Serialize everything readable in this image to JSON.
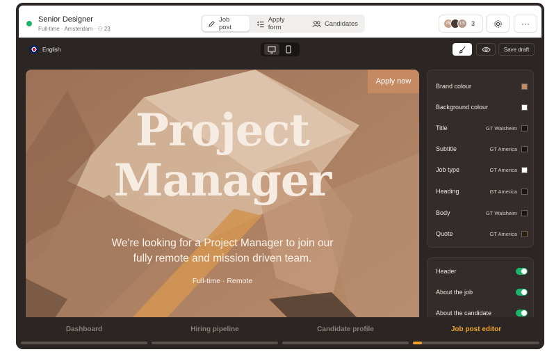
{
  "header": {
    "job_title": "Senior Designer",
    "job_meta": "Full-time · Amsterdam · ⚇ 23",
    "tabs": [
      {
        "label": "Job post",
        "icon": "pencil-icon",
        "active": true
      },
      {
        "label": "Apply form",
        "icon": "checklist-icon",
        "active": false
      },
      {
        "label": "Candidates",
        "icon": "users-icon",
        "active": false
      }
    ],
    "avatars": [
      "IB",
      "",
      "LS"
    ],
    "avatar_count": "3",
    "settings_icon": "gear-icon",
    "more_icon": "ellipsis-icon"
  },
  "toolbar": {
    "language": "English",
    "save_label": "Save draft"
  },
  "hero": {
    "apply_label": "Apply now",
    "title_line1": "Project",
    "title_line2": "Manager",
    "subtitle_line1": "We're looking for a Project Manager to join our",
    "subtitle_line2": "fully remote and mission driven team.",
    "meta": "Full-time · Remote"
  },
  "style_panel": {
    "rows": [
      {
        "label": "Brand colour",
        "value": "",
        "swatch": "#c58a62"
      },
      {
        "label": "Background colour",
        "value": "",
        "swatch": "#ffffff"
      },
      {
        "label": "Title",
        "value": "GT Walsheim",
        "swatch": "#1a1614"
      },
      {
        "label": "Subtitle",
        "value": "GT America",
        "swatch": "#1a1614"
      },
      {
        "label": "Job type",
        "value": "GT America",
        "swatch": "#ffffff"
      },
      {
        "label": "Heading",
        "value": "GT America",
        "swatch": "#1a1614"
      },
      {
        "label": "Body",
        "value": "GT Walsheim",
        "swatch": "#1a1614"
      },
      {
        "label": "Quote",
        "value": "GT America",
        "swatch": "#2a1f10"
      }
    ]
  },
  "sections_panel": {
    "rows": [
      {
        "label": "Header",
        "enabled": true
      },
      {
        "label": "About the job",
        "enabled": true
      },
      {
        "label": "About the candidate",
        "enabled": true
      }
    ]
  },
  "bottom_nav": {
    "tabs": [
      {
        "label": "Dashboard",
        "active": false,
        "progress": 1.0
      },
      {
        "label": "Hiring pipeline",
        "active": false,
        "progress": 1.0
      },
      {
        "label": "Candidate profile",
        "active": false,
        "progress": 1.0
      },
      {
        "label": "Job post editor",
        "active": true,
        "progress": 0.07
      }
    ]
  },
  "colors": {
    "accent": "#f0a52a",
    "brand": "#c58a62",
    "status_green": "#1db36a",
    "dark_bg": "#2b2523"
  }
}
